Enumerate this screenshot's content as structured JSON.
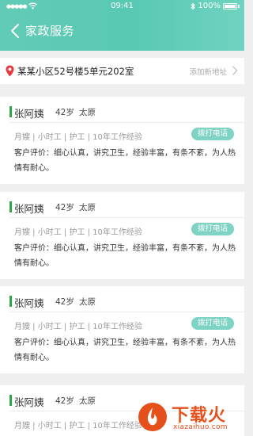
{
  "status_bar": {
    "time": "09:41",
    "battery": "100%"
  },
  "nav": {
    "title": "家政服务"
  },
  "address": {
    "text": "某某小区52号楼5单元202室",
    "add_label": "添加新地址"
  },
  "cards": [
    {
      "name": "张阿姨",
      "age": "42岁",
      "city": "太原",
      "tags": "月嫂 | 小时工 | 护工 | 10年工作经验",
      "call_label": "拨打电话",
      "review": "客户评价：细心认真，讲究卫生，经验丰富，有条不紊，为人热情有耐心。"
    },
    {
      "name": "张阿姨",
      "age": "42岁",
      "city": "太原",
      "tags": "月嫂 | 小时工 | 护工 | 10年工作经验",
      "call_label": "拨打电话",
      "review": "客户评价：细心认真，讲究卫生，经验丰富，有条不紊，为人热情有耐心。"
    },
    {
      "name": "张阿姨",
      "age": "42岁",
      "city": "太原",
      "tags": "月嫂 | 小时工 | 护工 | 10年工作经验",
      "call_label": "拨打电话",
      "review": "客户评价：细心认真，讲究卫生，经验丰富，有条不紊，为人热情有耐心。"
    },
    {
      "name": "张阿姨",
      "age": "42岁",
      "city": "太原",
      "tags": "月嫂 | 小时工 | 护工 | 10年工作经验"
    }
  ],
  "watermark": {
    "text": "下载火",
    "sub": "xiazaihuo.com"
  },
  "colors": {
    "header": "#5ecab5",
    "accent_bar": "#2aa846",
    "call_button": "#7fd3c4",
    "pin": "#e8383d"
  },
  "icons": [
    "wifi-icon",
    "bluetooth-icon",
    "battery-icon",
    "back-icon",
    "location-pin-icon",
    "chevron-right-icon"
  ]
}
